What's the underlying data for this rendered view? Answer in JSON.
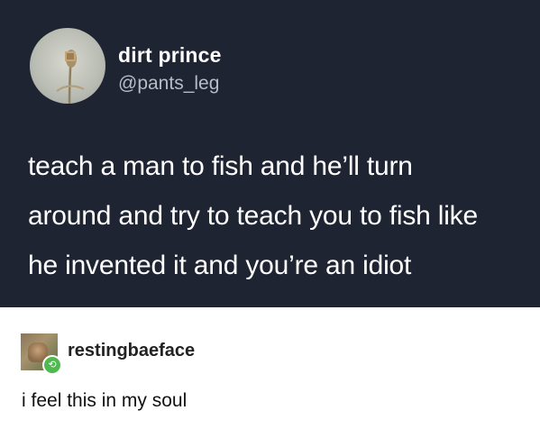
{
  "tweet": {
    "display_name": "dirt prince",
    "handle": "@pants_leg",
    "text_lines": [
      "teach a man to fish and he’ll turn",
      "around and try to teach you to fish like",
      "he invented it and you’re an idiot"
    ]
  },
  "reblog": {
    "username": "restingbaeface",
    "text": "i feel this in my soul",
    "badge_icon": "reblog-icon"
  },
  "colors": {
    "tweet_background": "#1f2432",
    "reblog_badge": "#4fb94f"
  }
}
